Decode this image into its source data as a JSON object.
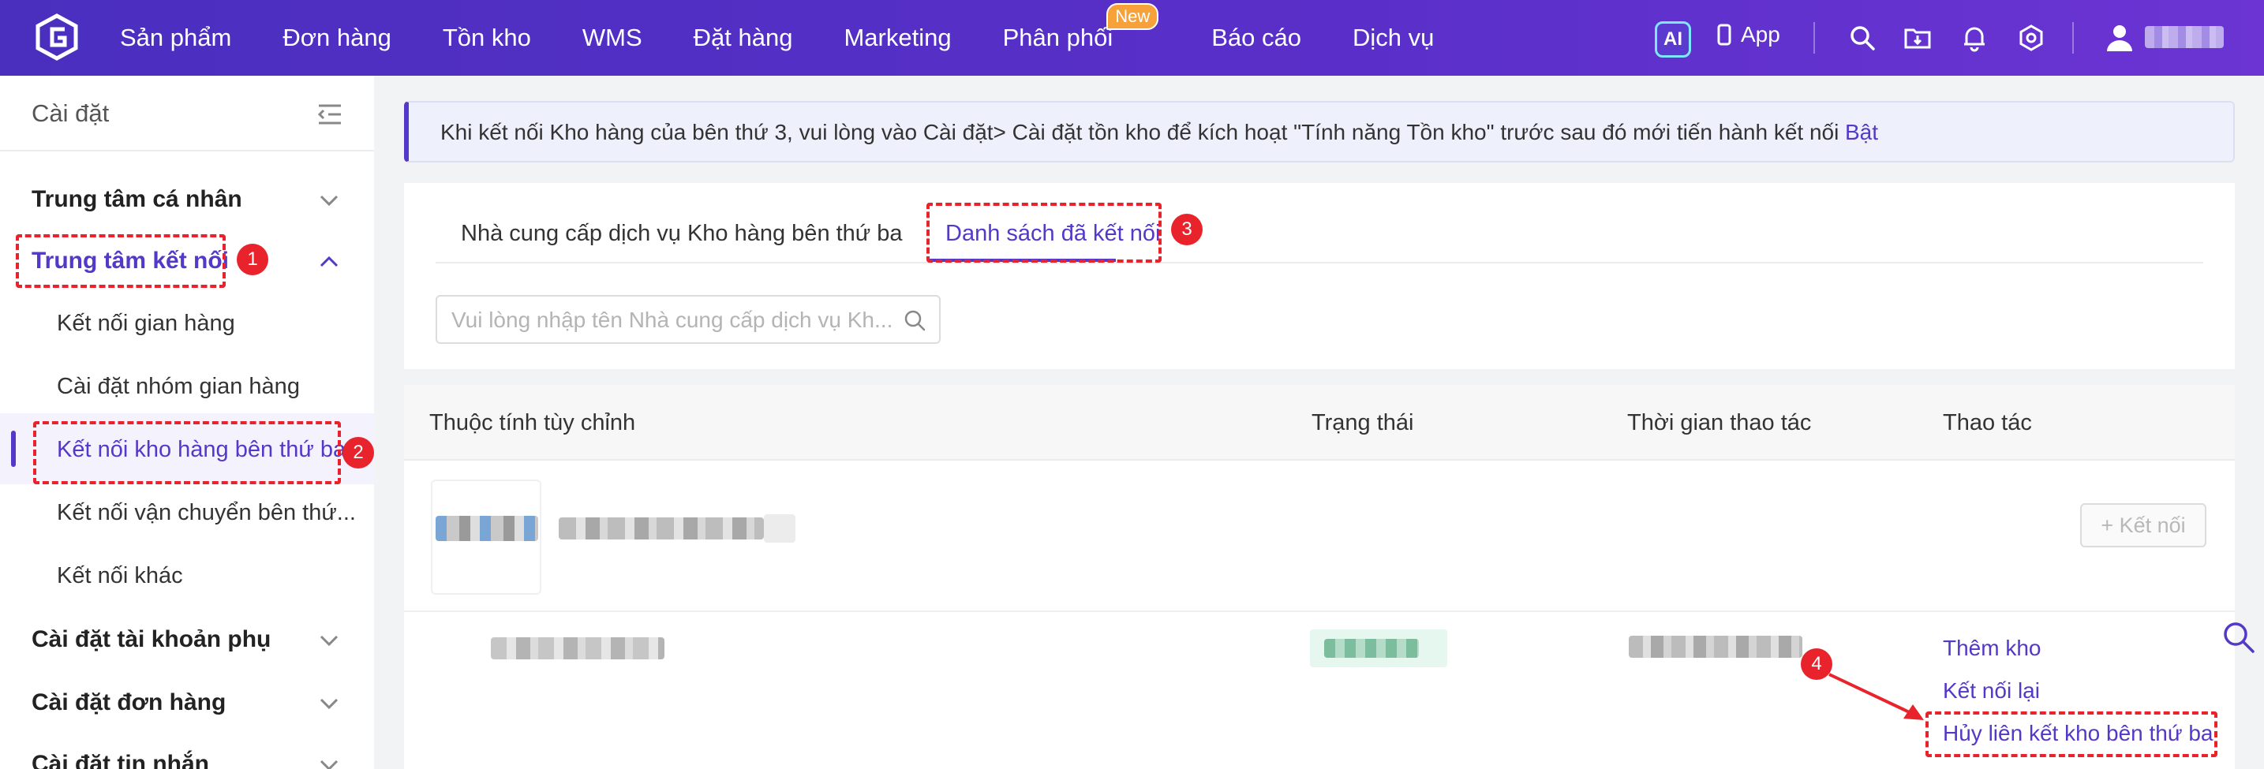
{
  "topbar": {
    "nav": [
      {
        "label": "Sản phẩm"
      },
      {
        "label": "Đơn hàng"
      },
      {
        "label": "Tồn kho"
      },
      {
        "label": "WMS"
      },
      {
        "label": "Đặt hàng"
      },
      {
        "label": "Marketing"
      },
      {
        "label": "Phân phối",
        "badge": "New"
      },
      {
        "label": "Báo cáo"
      },
      {
        "label": "Dịch vụ"
      }
    ],
    "ai_label": "AI",
    "app_label": "App",
    "icons": [
      "search-icon",
      "folder-download-icon",
      "bell-icon",
      "gear-icon",
      "user-icon"
    ]
  },
  "sidebar": {
    "title": "Cài đặt",
    "groups": [
      {
        "label": "Trung tâm cá nhân"
      },
      {
        "label": "Trung tâm kết nối"
      },
      {
        "label": "Cài đặt tài khoản phụ"
      },
      {
        "label": "Cài đặt đơn hàng"
      },
      {
        "label": "Cài đặt tin nhắn"
      }
    ],
    "items": [
      {
        "label": "Kết nối gian hàng"
      },
      {
        "label": "Cài đặt nhóm gian hàng"
      },
      {
        "label": "Kết nối kho hàng bên thứ ba"
      },
      {
        "label": "Kết nối vận chuyển bên thứ..."
      },
      {
        "label": "Kết nối khác"
      }
    ]
  },
  "notice": {
    "text": "Khi kết nối Kho hàng của bên thứ 3, vui lòng vào Cài đặt> Cài đặt tồn kho để kích hoạt \"Tính năng Tồn kho\" trước sau đó mới tiến hành kết nối",
    "link": "Bật"
  },
  "tabs": [
    {
      "label": "Nhà cung cấp dịch vụ Kho hàng bên thứ ba"
    },
    {
      "label": "Danh sách đã kết nối"
    }
  ],
  "search": {
    "placeholder": "Vui lòng nhập tên Nhà cung cấp dịch vụ Kh..."
  },
  "table": {
    "columns": [
      "Thuộc tính tùy chỉnh",
      "Trạng thái",
      "Thời gian thao tác",
      "Thao tác"
    ],
    "connect_button": "+ Kết nối",
    "actions": [
      "Thêm kho",
      "Kết nối lại",
      "Hủy liên kết kho bên thứ ba"
    ]
  },
  "annotations": [
    "1",
    "2",
    "3",
    "4"
  ],
  "colors": {
    "brand": "#5438c8",
    "annotation": "#e8232c"
  }
}
